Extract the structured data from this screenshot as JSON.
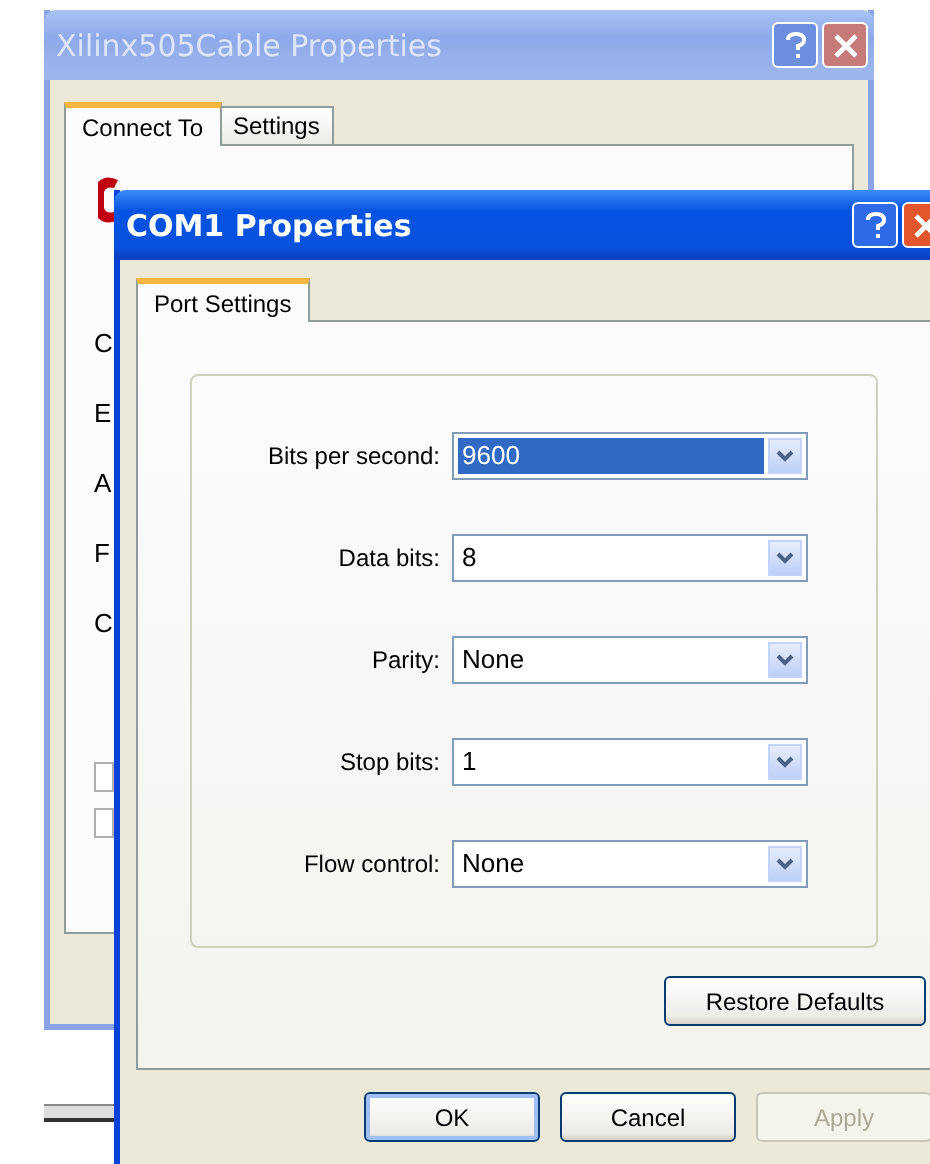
{
  "back_window": {
    "title": "Xilinx505Cable Properties",
    "active": false,
    "tabs": [
      {
        "label": "Connect To",
        "selected": true
      },
      {
        "label": "Settings",
        "selected": false
      }
    ],
    "cut_labels": [
      "C",
      "E",
      "A",
      "F",
      "C"
    ],
    "checkboxes": [
      {
        "checked": false
      },
      {
        "checked": false
      }
    ]
  },
  "front_window": {
    "title": "COM1 Properties",
    "active": true,
    "tabs": [
      {
        "label": "Port Settings",
        "selected": true
      }
    ],
    "fields": [
      {
        "label": "Bits per second:",
        "value": "9600",
        "focused": true
      },
      {
        "label": "Data bits:",
        "value": "8",
        "focused": false
      },
      {
        "label": "Parity:",
        "value": "None",
        "focused": false
      },
      {
        "label": "Stop bits:",
        "value": "1",
        "focused": false
      },
      {
        "label": "Flow control:",
        "value": "None",
        "focused": false
      }
    ],
    "restore_button": "Restore Defaults",
    "buttons": [
      {
        "label": "OK",
        "disabled": false,
        "default": true
      },
      {
        "label": "Cancel",
        "disabled": false,
        "default": false
      },
      {
        "label": "Apply",
        "disabled": true,
        "default": false
      }
    ]
  }
}
